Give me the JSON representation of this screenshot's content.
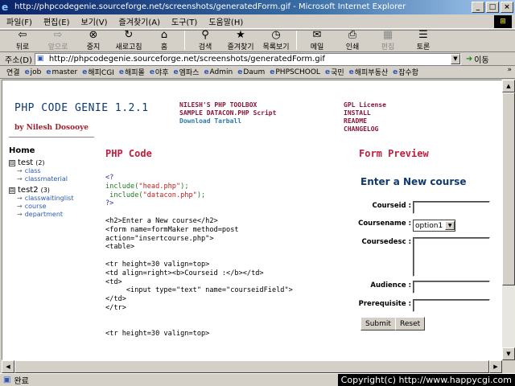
{
  "window": {
    "title": "http://phpcodegenie.sourceforge.net/screenshots/generatedForm.gif - Microsoft Internet Explorer",
    "btn_min": "_",
    "btn_max": "□",
    "btn_close": "×"
  },
  "menu": {
    "items": [
      "파일(F)",
      "편집(E)",
      "보기(V)",
      "즐겨찾기(A)",
      "도구(T)",
      "도움말(H)"
    ]
  },
  "toolbar": {
    "back": "뒤로",
    "forward": "앞으로",
    "stop": "중지",
    "refresh": "새로고침",
    "home": "홈",
    "search": "검색",
    "favorites": "즐겨찾기",
    "history": "목록보기",
    "mail": "메일",
    "print": "인쇄",
    "edit": "편집",
    "discuss": "토론"
  },
  "address": {
    "label": "주소(D)",
    "url": "http://phpcodegenie.sourceforge.net/screenshots/generatedForm.gif",
    "go": "이동"
  },
  "links": {
    "label": "연결",
    "items": [
      "job",
      "master",
      "해피CGI",
      "해피몰",
      "야후",
      "엠파스",
      "Admin",
      "Daum",
      "PHPSCHOOL",
      "국민",
      "해피부동산",
      "잡수함"
    ],
    "more": "»"
  },
  "page": {
    "logo": "PHP CODE GENIE 1.2.1",
    "author": "by Nilesh Dosooye",
    "toolbox_link": "NILESH'S PHP TOOLBOX",
    "sample_link": "SAMPLE DATACON.PHP Script",
    "download_link": "Download Tarball",
    "gpl_link": "GPL License",
    "install_link": "INSTALL",
    "readme_link": "README",
    "changelog_link": "CHANGELOG",
    "home_link": "Home",
    "groups": [
      {
        "name": "test",
        "count": "(2)",
        "toggle": "⊟",
        "items": [
          "class",
          "classmaterial"
        ]
      },
      {
        "name": "test2",
        "count": "(3)",
        "toggle": "⊟",
        "items": [
          "classwaitinglist",
          "course",
          "department"
        ]
      }
    ],
    "php_code_title": "PHP Code",
    "form_preview_title": "Form Preview",
    "form": {
      "title": "Enter a New course",
      "courseid_label": "Courseid :",
      "coursename_label": "Coursename :",
      "coursename_value": "option1",
      "coursedesc_label": "Coursedesc :",
      "audience_label": "Audience :",
      "prerequisite_label": "Prerequisite :",
      "submit_label": "Submit",
      "reset_label": "Reset"
    },
    "code": {
      "l1": "<?",
      "l2a": "include(",
      "l2b": "\"head.php\"",
      "l2c": ");",
      "l3a": " include(",
      "l3b": "\"datacon.php\"",
      "l3c": ");",
      "l4": "?>",
      "l5": "",
      "l6": "<h2>Enter a New course</h2>",
      "l7": "<form name=formMaker method=post",
      "l8": "action=\"insertcourse.php\">",
      "l9": "<table>",
      "l10": "",
      "l11": "<tr height=30 valign=top>",
      "l12": "<td align=right><b>Courseid :</b></td>",
      "l13": "<td>",
      "l14": "     <input type=\"text\" name=\"courseidField\">",
      "l15": "</td>",
      "l16": "</tr>",
      "l17": "",
      "l18": "",
      "l19": "<tr height=30 valign=top>"
    }
  },
  "status": {
    "text": "완료",
    "copyright": "Copyright(c) http://www.happycgi.com"
  }
}
